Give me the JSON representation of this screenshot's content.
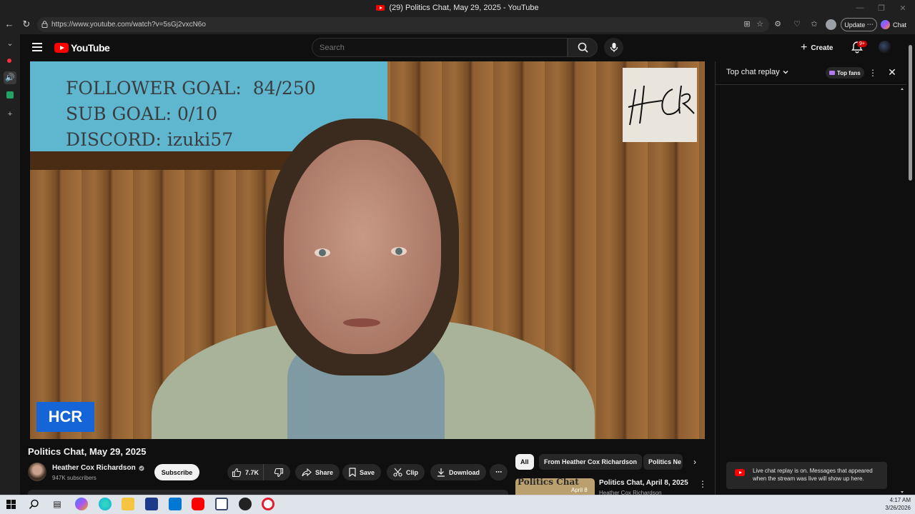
{
  "browser": {
    "window_title": "(29) Politics Chat, May 29, 2025 - YouTube",
    "url": "https://www.youtube.com/watch?v=5sGj2vxcN6o",
    "update_label": "Update",
    "chat_label": "Chat"
  },
  "youtube": {
    "logo_text": "YouTube",
    "search_placeholder": "Search",
    "create_label": "Create",
    "notification_count": "9+"
  },
  "video": {
    "overlay_lines": [
      "FOLLOWER GOAL:  84/250",
      "SUB GOAL: 0/10",
      "DISCORD: izuki57"
    ],
    "corner_badge": "HCR",
    "title": "Politics Chat, May 29, 2025"
  },
  "channel": {
    "name": "Heather Cox Richardson",
    "subscribers": "947K subscribers",
    "subscribe_label": "Subscribe"
  },
  "actions": {
    "likes": "7.7K",
    "share": "Share",
    "save": "Save",
    "clip": "Clip",
    "download": "Download"
  },
  "chips": [
    "All",
    "From Heather Cox Richardson",
    "Politics Ne"
  ],
  "recommended": {
    "thumb_text": "Politics Chat",
    "thumb_date": "April 8",
    "title": "Politics Chat, April 8, 2025",
    "channel": "Heather Cox Richardson"
  },
  "chat": {
    "title": "Top chat replay",
    "top_fans": "Top fans",
    "notice": "Live chat replay is on. Messages that appeared when the stream was live will show up here."
  },
  "taskbar": {
    "time": "4:17 AM",
    "date": "3/26/2026"
  },
  "colors": {
    "youtube_red": "#ff0000",
    "hcr_badge": "#1565d8",
    "background": "#0f0f0f"
  }
}
